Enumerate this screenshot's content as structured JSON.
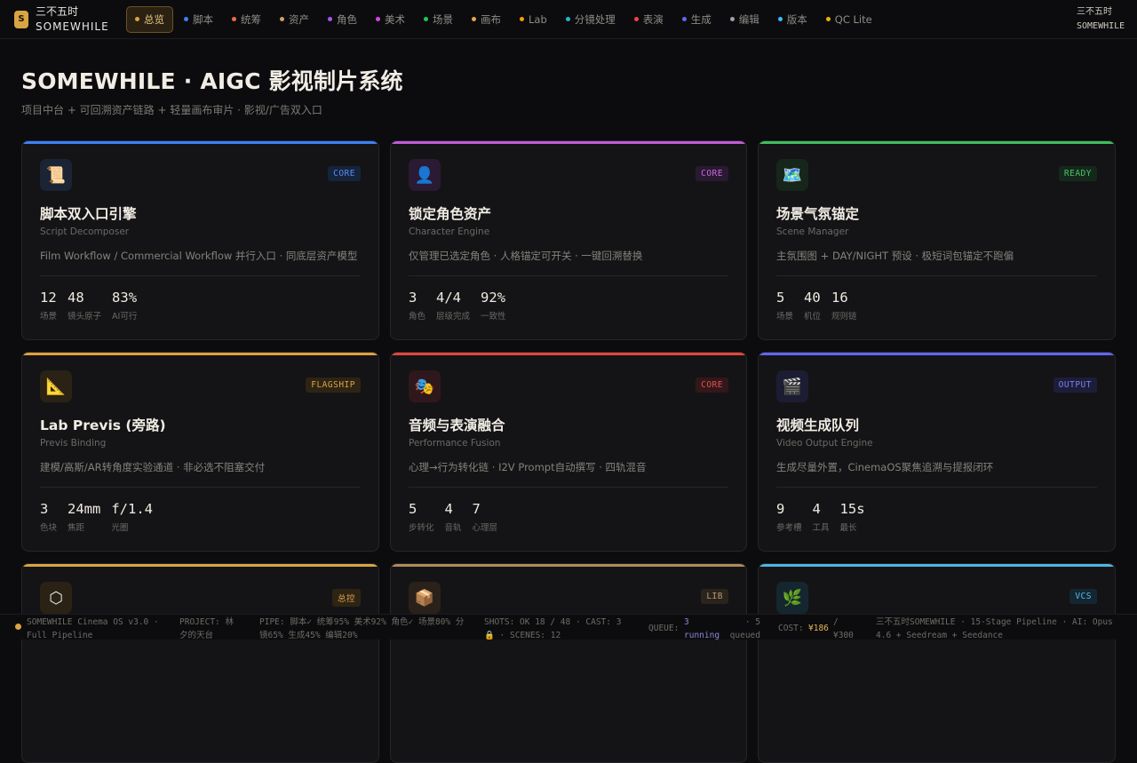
{
  "brand": {
    "logo": "S",
    "name_cn": "三不五时",
    "name_en": "SOMEWHILE"
  },
  "nav": [
    {
      "label": "总览",
      "dot": "#d9a441",
      "active": true
    },
    {
      "label": "脚本",
      "dot": "#3b82f6"
    },
    {
      "label": "统筹",
      "dot": "#ef6b4a"
    },
    {
      "label": "资产",
      "dot": "#c9a36b"
    },
    {
      "label": "角色",
      "dot": "#a855f7"
    },
    {
      "label": "美术",
      "dot": "#d946ef"
    },
    {
      "label": "场景",
      "dot": "#22c55e"
    },
    {
      "label": "画布",
      "dot": "#e6a84a"
    },
    {
      "label": "Lab",
      "dot": "#f59e0b"
    },
    {
      "label": "分镜处理",
      "dot": "#22b8cf"
    },
    {
      "label": "表演",
      "dot": "#ef4444"
    },
    {
      "label": "生成",
      "dot": "#6366f1"
    },
    {
      "label": "编辑",
      "dot": "#9ca3af"
    },
    {
      "label": "版本",
      "dot": "#38bdf8"
    },
    {
      "label": "QC Lite",
      "dot": "#eab308"
    }
  ],
  "top_right": {
    "line1": "三不五时",
    "line2": "SOMEWHILE"
  },
  "header": {
    "title": "SOMEWHILE · AIGC 影视制片系统",
    "subtitle": "项目中台 + 可回溯资产链路 + 轻量画布审片 · 影视/广告双入口"
  },
  "cards": [
    {
      "icon": "📜",
      "icon_name": "scroll-icon",
      "badge": "CORE",
      "accent": "#3b82f6",
      "badge_color": "#5b8def",
      "badge_bg": "#15233d",
      "icon_bg": "#1a2435",
      "title": "脚本双入口引擎",
      "subtitle": "Script Decomposer",
      "desc": "Film Workflow / Commercial Workflow 并行入口 · 同底层资产模型",
      "stats": [
        {
          "value": "12",
          "label": "场景"
        },
        {
          "value": "48",
          "label": "镜头原子"
        },
        {
          "value": "83%",
          "label": "AI可行"
        }
      ]
    },
    {
      "icon": "👤",
      "icon_name": "person-icon",
      "badge": "CORE",
      "accent": "#c05bd6",
      "badge_color": "#c76bdc",
      "badge_bg": "#2a1933",
      "icon_bg": "#2a1a33",
      "title": "锁定角色资产",
      "subtitle": "Character Engine",
      "desc": "仅管理已选定角色 · 人格锚定可开关 · 一键回溯替换",
      "stats": [
        {
          "value": "3",
          "label": "角色"
        },
        {
          "value": "4/4",
          "label": "层级完成"
        },
        {
          "value": "92%",
          "label": "一致性"
        }
      ]
    },
    {
      "icon": "🗺️",
      "icon_name": "map-icon",
      "badge": "READY",
      "accent": "#3fbf5c",
      "badge_color": "#4cc36a",
      "badge_bg": "#14291b",
      "icon_bg": "#16261b",
      "title": "场景气氛锚定",
      "subtitle": "Scene Manager",
      "desc": "主氛围图 + DAY/NIGHT 预设 · 极短词包锚定不跑偏",
      "stats": [
        {
          "value": "5",
          "label": "场景"
        },
        {
          "value": "40",
          "label": "机位"
        },
        {
          "value": "16",
          "label": "规则链"
        }
      ]
    },
    {
      "icon": "📐",
      "icon_name": "triangle-ruler-icon",
      "badge": "FLAGSHIP",
      "accent": "#e0a040",
      "badge_color": "#dca24e",
      "badge_bg": "#2e2413",
      "icon_bg": "#2a2215",
      "title": "Lab Previs (旁路)",
      "subtitle": "Previs Binding",
      "desc": "建模/高斯/AR转角度实验通道 · 非必选不阻塞交付",
      "stats": [
        {
          "value": "3",
          "label": "色块"
        },
        {
          "value": "24mm",
          "label": "焦距"
        },
        {
          "value": "f/1.4",
          "label": "光圈"
        }
      ]
    },
    {
      "icon": "🎭",
      "icon_name": "theater-masks-icon",
      "badge": "CORE",
      "accent": "#e2463f",
      "badge_color": "#e0544c",
      "badge_bg": "#33171a",
      "icon_bg": "#2f181b",
      "title": "音频与表演融合",
      "subtitle": "Performance Fusion",
      "desc": "心理→行为转化链 · I2V Prompt自动撰写 · 四轨混音",
      "stats": [
        {
          "value": "5",
          "label": "步转化"
        },
        {
          "value": "4",
          "label": "音轨"
        },
        {
          "value": "7",
          "label": "心理层"
        }
      ]
    },
    {
      "icon": "🎬",
      "icon_name": "clapperboard-icon",
      "badge": "OUTPUT",
      "accent": "#6366f1",
      "badge_color": "#7c7ff0",
      "badge_bg": "#1d1d3a",
      "icon_bg": "#1c1d33",
      "title": "视频生成队列",
      "subtitle": "Video Output Engine",
      "desc": "生成尽量外置，CinemaOS聚焦追溯与提报闭环",
      "stats": [
        {
          "value": "9",
          "label": "参考槽"
        },
        {
          "value": "4",
          "label": "工具"
        },
        {
          "value": "15s",
          "label": "最长"
        }
      ]
    },
    {
      "icon": "⬡",
      "icon_name": "hexagon-icon",
      "badge": "总控",
      "accent": "#d9a441",
      "badge_color": "#dca24e",
      "badge_bg": "#2e2413",
      "icon_bg": "#2a2215",
      "title": "",
      "subtitle": "",
      "desc": "",
      "stats": []
    },
    {
      "icon": "📦",
      "icon_name": "package-icon",
      "badge": "LIB",
      "accent": "#b08a5a",
      "badge_color": "#b89a73",
      "badge_bg": "#2a241c",
      "icon_bg": "#2a221a",
      "title": "",
      "subtitle": "",
      "desc": "",
      "stats": []
    },
    {
      "icon": "🌿",
      "icon_name": "herb-icon",
      "badge": "VCS",
      "accent": "#4fb6e6",
      "badge_color": "#5fbde8",
      "badge_bg": "#132631",
      "icon_bg": "#15262e",
      "title": "",
      "subtitle": "",
      "desc": "",
      "stats": []
    }
  ],
  "status": {
    "app": "SOMEWHILE Cinema OS v3.0 · Full Pipeline",
    "project": "PROJECT: 林夕的天台",
    "pipe": "PIPE: 脚本✓ 统筹95% 美术92% 角色✓ 场景80% 分镜65% 生成45% 编辑20%",
    "shots": "SHOTS: OK 18 / 48 · CAST: 3🔒 · SCENES: 12",
    "queue_label": "QUEUE:",
    "queue_running_count": "3",
    "queue_running": "running",
    "queue_queued_count": "· 5",
    "queue_queued": "queued",
    "cost_label": "COST:",
    "cost_value": "¥186",
    "cost_total": "/ ¥300",
    "stack": "三不五时SOMEWHILE · 15-Stage Pipeline · AI: Opus 4.6 + Seedream + Seedance"
  }
}
